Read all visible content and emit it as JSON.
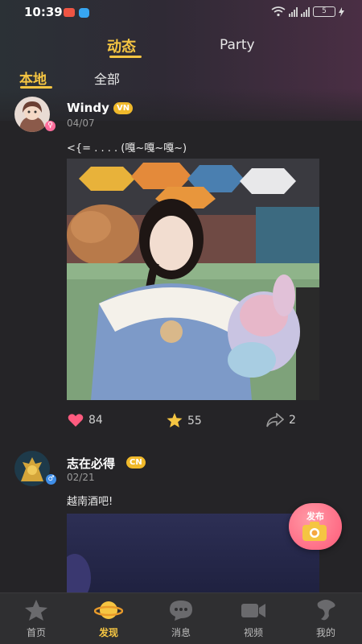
{
  "status_bar": {
    "time": "10:39",
    "battery": "5"
  },
  "top_tabs": [
    {
      "label": "动态",
      "active": true
    },
    {
      "label": "Party",
      "active": false
    }
  ],
  "sub_tabs": [
    {
      "label": "本地",
      "active": true
    },
    {
      "label": "全部",
      "active": false
    }
  ],
  "posts": [
    {
      "username": "Windy",
      "badge": "VN",
      "date": "04/07",
      "text": "<{= . . . . (嘎~嘎~嘎~)",
      "likes": "84",
      "stars": "55",
      "shares": "2",
      "has_photo": true
    },
    {
      "username": "志在必得",
      "badge": "CN",
      "date": "02/21",
      "text": "越南酒吧!",
      "has_photo": true
    }
  ],
  "fab": {
    "label": "发布",
    "icon": "camera-icon"
  },
  "bottom_nav": [
    {
      "label": "首页",
      "icon": "star-shape-icon",
      "active": false
    },
    {
      "label": "发现",
      "icon": "planet-icon",
      "active": true
    },
    {
      "label": "消息",
      "icon": "chat-bubble-icon",
      "active": false
    },
    {
      "label": "视频",
      "icon": "video-camera-icon",
      "active": false
    },
    {
      "label": "我的",
      "icon": "profile-icon",
      "active": false
    }
  ],
  "colors": {
    "accent": "#f5c542",
    "background": "#252427",
    "like": "#ff5b7f",
    "fab": "#ff6d86"
  }
}
